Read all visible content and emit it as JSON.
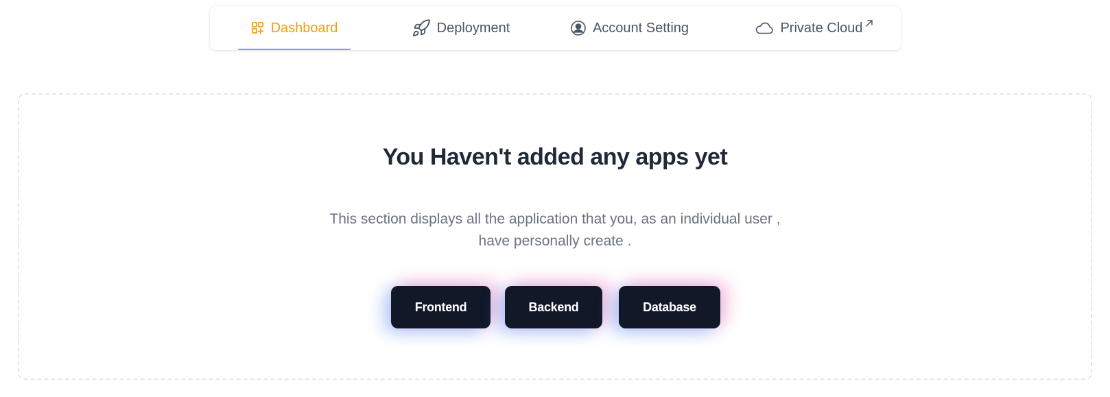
{
  "nav": {
    "tabs": [
      {
        "label": "Dashboard",
        "icon": "dashboard-grid-icon",
        "active": true
      },
      {
        "label": "Deployment",
        "icon": "rocket-icon",
        "active": false
      },
      {
        "label": "Account Setting",
        "icon": "user-circle-icon",
        "active": false
      },
      {
        "label": "Private Cloud",
        "icon": "cloud-icon",
        "external_icon": "external-link-arrow-icon",
        "active": false
      }
    ]
  },
  "empty_state": {
    "title": "You Haven't added any apps yet",
    "description_line1": "This section displays all the application that you, as an individual user ,",
    "description_line2": "have personally create ."
  },
  "buttons": {
    "frontend": "Frontend",
    "backend": "Backend",
    "database": "Database"
  },
  "colors": {
    "active_tab_text": "#f59e0b",
    "active_tab_underline": "#60a5fa",
    "button_bg": "#111827",
    "glow_blue": "#3b82f6",
    "glow_pink": "#f472b6"
  }
}
